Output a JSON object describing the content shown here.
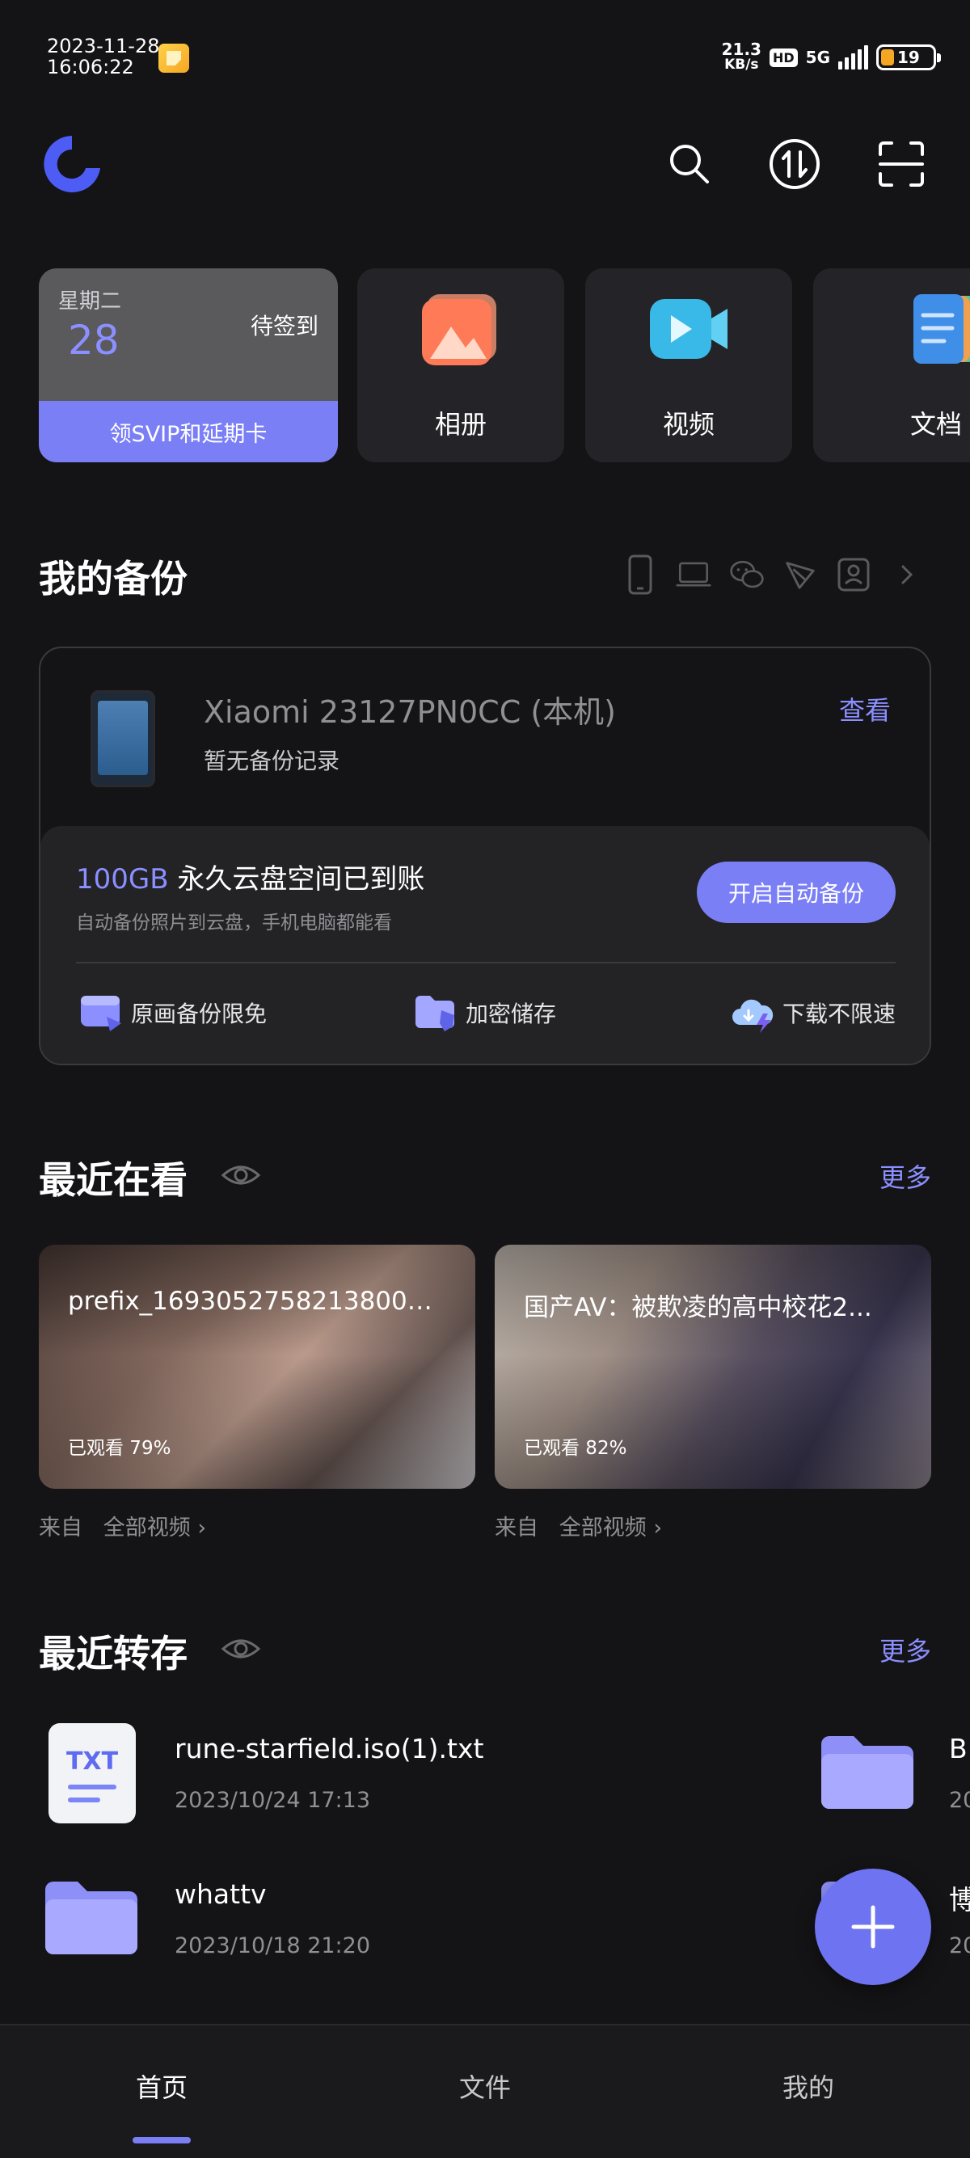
{
  "status_bar": {
    "date": "2023-11-28",
    "time": "16:06:22",
    "net_speed_value": "21.3",
    "net_speed_unit": "KB/s",
    "hd": "HD",
    "network": "5G",
    "battery": "19"
  },
  "quick_cards": {
    "checkin": {
      "weekday": "星期二",
      "day": "28",
      "status": "待签到",
      "cta": "领SVIP和延期卡"
    },
    "album": "相册",
    "video": "视频",
    "docs": "文档"
  },
  "backup": {
    "title": "我的备份",
    "device_name": "Xiaomi 23127PN0CC (本机)",
    "view": "查看",
    "no_record": "暂无备份记录",
    "promo_highlight": "100GB",
    "promo_title": " 永久云盘空间已到账",
    "promo_sub": "自动备份照片到云盘，手机电脑都能看",
    "auto_backup_button": "开启自动备份",
    "features": [
      "原画备份限免",
      "加密储存",
      "下载不限速"
    ]
  },
  "recent_watch": {
    "title": "最近在看",
    "more": "更多",
    "videos": [
      {
        "title": "prefix_16930527582138001...",
        "progress": "已观看 79%",
        "source_prefix": "来自",
        "source": "全部视频"
      },
      {
        "title": "国产AV：被欺凌的高中校花2...",
        "progress": "已观看 82%",
        "source_prefix": "来自",
        "source": "全部视频"
      }
    ]
  },
  "recent_saves": {
    "title": "最近转存",
    "more": "更多",
    "files": [
      {
        "name": "rune-starfield.iso(1).txt",
        "date": "2023/10/24 17:13",
        "icon": "TXT"
      },
      {
        "name": "whattv",
        "date": "2023/10/18 21:20"
      },
      {
        "name": "B",
        "date": "20"
      },
      {
        "name": "博",
        "date": "20"
      }
    ]
  },
  "bottom_nav": [
    "首页",
    "文件",
    "我的"
  ],
  "colors": {
    "accent": "#7b7ff6",
    "background": "#141416",
    "card": "#242428"
  }
}
